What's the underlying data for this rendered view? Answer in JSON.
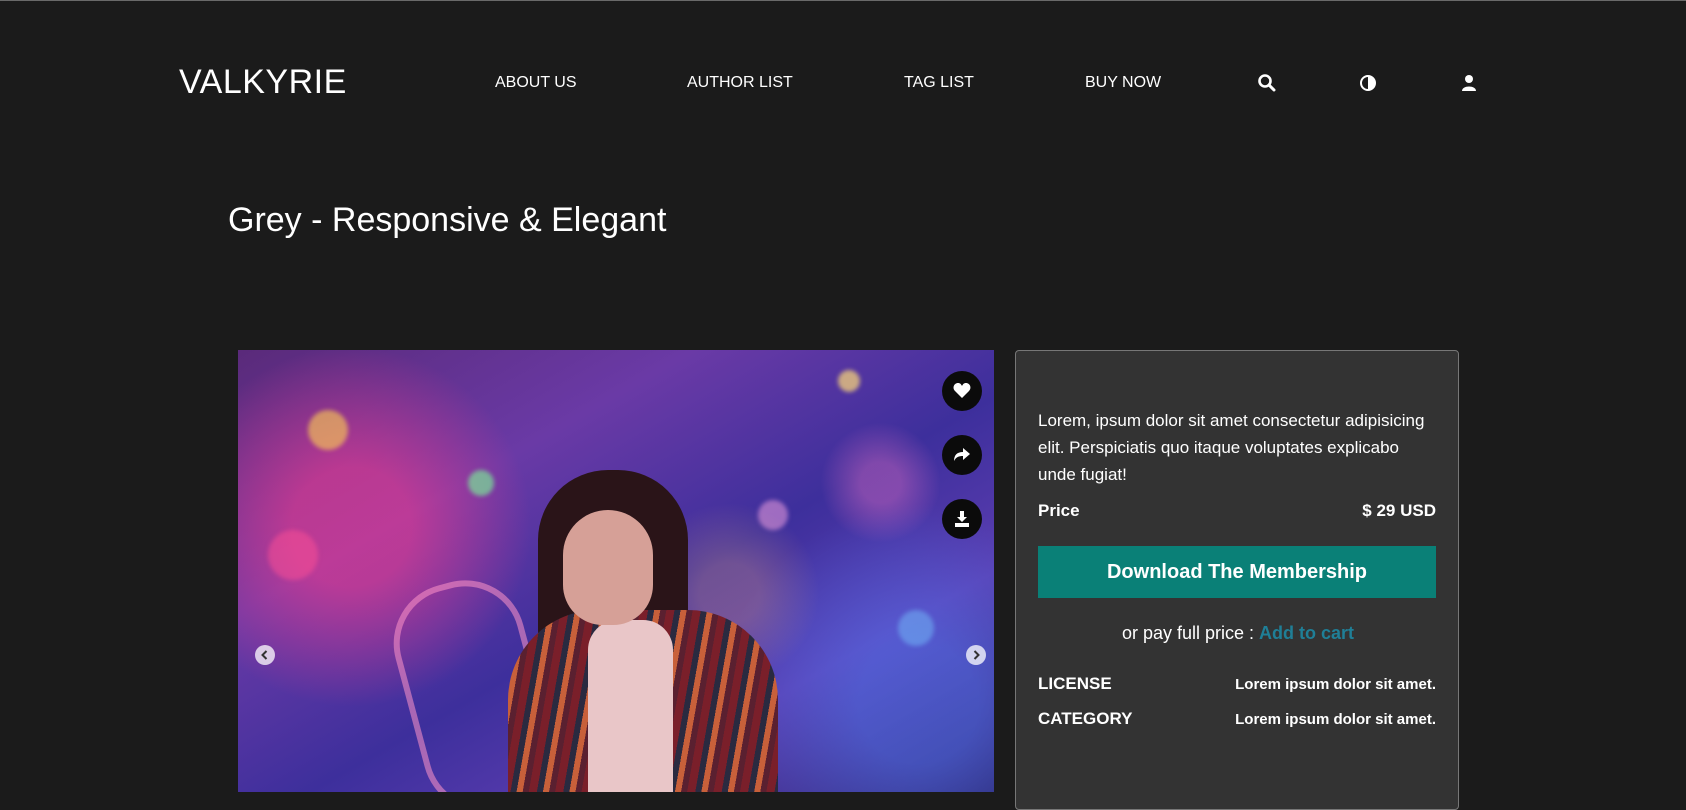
{
  "header": {
    "logo": "VALKYRIE",
    "nav": {
      "about_us": "ABOUT US",
      "author_list": "AUTHOR LIST",
      "tag_list": "TAG LIST",
      "buy_now": "BUY NOW"
    },
    "icons": [
      "search-icon",
      "contrast-icon",
      "user-icon"
    ]
  },
  "page": {
    "title": "Grey - Responsive & Elegant"
  },
  "gallery": {
    "actions": [
      "heart-icon",
      "share-icon",
      "download-icon"
    ],
    "controls": [
      "chevron-left-icon",
      "chevron-right-icon"
    ]
  },
  "product": {
    "description": "Lorem, ipsum dolor sit amet consectetur adipisicing elit. Perspiciatis quo itaque voluptates explicabo unde fugiat!",
    "price_label": "Price",
    "price_value": "$ 29 USD",
    "cta_label": "Download The Membership",
    "pay_text": "or pay full price : ",
    "add_to_cart": "Add to cart",
    "license_label": "LICENSE",
    "license_value": "Lorem ipsum dolor sit amet.",
    "category_label": "CATEGORY",
    "category_value": "Lorem ipsum dolor sit amet."
  },
  "colors": {
    "background": "#1b1b1b",
    "panel": "#333333",
    "accent": "#0a8077",
    "link": "#1f7f97"
  }
}
